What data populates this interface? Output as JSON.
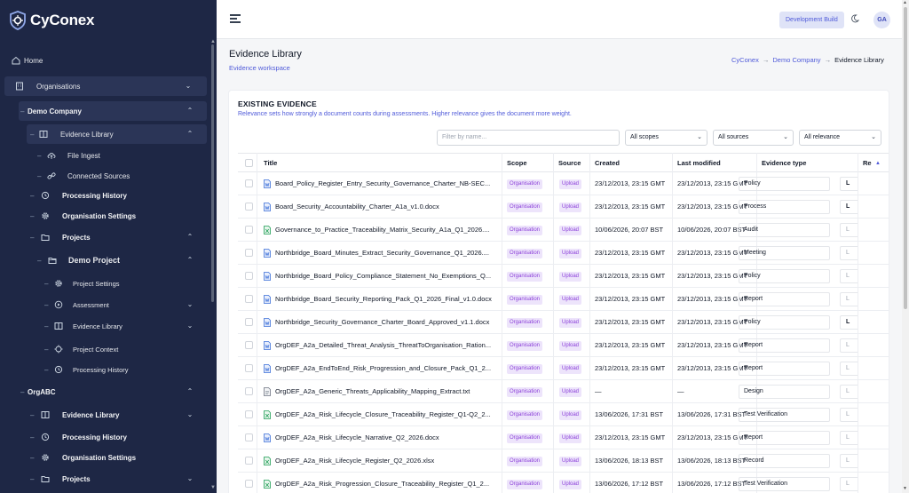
{
  "app": {
    "name": "CyConex"
  },
  "sidebar": {
    "home": "Home",
    "organisations": "Organisations",
    "demo_company": {
      "label": "Demo Company",
      "evidence_library": "Evidence Library",
      "file_ingest": "File Ingest",
      "connected_sources": "Connected Sources",
      "processing_history": "Processing History",
      "organisation_settings": "Organisation Settings",
      "projects": "Projects",
      "demo_project": {
        "label": "Demo Project",
        "project_settings": "Project Settings",
        "assessment": "Assessment",
        "evidence_library": "Evidence Library",
        "project_context": "Project Context",
        "processing_history": "Processing History"
      }
    },
    "org_abc": {
      "label": "OrgABC",
      "evidence_library": "Evidence Library",
      "processing_history": "Processing History",
      "organisation_settings": "Organisation Settings",
      "projects": "Projects"
    }
  },
  "topbar": {
    "dev_build": "Development Build",
    "avatar": "GA"
  },
  "page": {
    "title": "Evidence Library",
    "subtitle": "Evidence workspace",
    "breadcrumb": [
      "CyConex",
      "Demo Company",
      "Evidence Library"
    ]
  },
  "card": {
    "title": "EXISTING EVIDENCE",
    "description": "Relevance sets how strongly a document counts during assessments. Higher relevance gives the document more weight.",
    "filter_placeholder": "Filter by name...",
    "scopes": "All scopes",
    "sources": "All sources",
    "relevance": "All relevance"
  },
  "table": {
    "headers": [
      "Title",
      "Scope",
      "Source",
      "Created",
      "Last modified",
      "Evidence type",
      "Re"
    ],
    "rows": [
      {
        "title": "Board_Policy_Register_Entry_Security_Governance_Charter_NB-SEC...",
        "icon": "doc",
        "scope": "Organisation",
        "source": "Upload",
        "created": "23/12/2013, 23:15 GMT",
        "modified": "23/12/2013, 23:15 GMT",
        "type": "Policy",
        "rel": "L",
        "rel_bold": true
      },
      {
        "title": "Board_Security_Accountability_Charter_A1a_v1.0.docx",
        "icon": "doc",
        "scope": "Organisation",
        "source": "Upload",
        "created": "23/12/2013, 23:15 GMT",
        "modified": "23/12/2013, 23:15 GMT",
        "type": "Process",
        "rel": "L",
        "rel_bold": true
      },
      {
        "title": "Governance_to_Practice_Traceability_Matrix_Security_A1a_Q1_2026....",
        "icon": "xls",
        "scope": "Organisation",
        "source": "Upload",
        "created": "10/06/2026, 20:07 BST",
        "modified": "10/06/2026, 20:07 BST",
        "type": "Audit",
        "rel": "L",
        "rel_bold": false
      },
      {
        "title": "Northbridge_Board_Minutes_Extract_Security_Governance_Q1_2026....",
        "icon": "doc",
        "scope": "Organisation",
        "source": "Upload",
        "created": "23/12/2013, 23:15 GMT",
        "modified": "23/12/2013, 23:15 GMT",
        "type": "Meeting",
        "rel": "L",
        "rel_bold": false
      },
      {
        "title": "Northbridge_Board_Policy_Compliance_Statement_No_Exemptions_Q...",
        "icon": "doc",
        "scope": "Organisation",
        "source": "Upload",
        "created": "23/12/2013, 23:15 GMT",
        "modified": "23/12/2013, 23:15 GMT",
        "type": "Policy",
        "rel": "L",
        "rel_bold": false
      },
      {
        "title": "Northbridge_Board_Security_Reporting_Pack_Q1_2026_Final_v1.0.docx",
        "icon": "doc",
        "scope": "Organisation",
        "source": "Upload",
        "created": "23/12/2013, 23:15 GMT",
        "modified": "23/12/2013, 23:15 GMT",
        "type": "Report",
        "rel": "L",
        "rel_bold": false
      },
      {
        "title": "Northbridge_Security_Governance_Charter_Board_Approved_v1.1.docx",
        "icon": "doc",
        "scope": "Organisation",
        "source": "Upload",
        "created": "23/12/2013, 23:15 GMT",
        "modified": "23/12/2013, 23:15 GMT",
        "type": "Policy",
        "rel": "L",
        "rel_bold": true
      },
      {
        "title": "OrgDEF_A2a_Detailed_Threat_Analysis_ThreatToOrganisation_Ration...",
        "icon": "doc",
        "scope": "Organisation",
        "source": "Upload",
        "created": "23/12/2013, 23:15 GMT",
        "modified": "23/12/2013, 23:15 GMT",
        "type": "Report",
        "rel": "L",
        "rel_bold": false
      },
      {
        "title": "OrgDEF_A2a_EndToEnd_Risk_Progression_and_Closure_Pack_Q1_2...",
        "icon": "doc",
        "scope": "Organisation",
        "source": "Upload",
        "created": "23/12/2013, 23:15 GMT",
        "modified": "23/12/2013, 23:15 GMT",
        "type": "Report",
        "rel": "L",
        "rel_bold": false
      },
      {
        "title": "OrgDEF_A2a_Generic_Threats_Applicability_Mapping_Extract.txt",
        "icon": "txt",
        "scope": "Organisation",
        "source": "Upload",
        "created": "—",
        "modified": "—",
        "type": "Design",
        "rel": "L",
        "rel_bold": false
      },
      {
        "title": "OrgDEF_A2a_Risk_Lifecycle_Closure_Traceability_Register_Q1-Q2_2...",
        "icon": "xls",
        "scope": "Organisation",
        "source": "Upload",
        "created": "13/06/2026, 17:31 BST",
        "modified": "13/06/2026, 17:31 BST",
        "type": "Test Verification",
        "rel": "L",
        "rel_bold": false
      },
      {
        "title": "OrgDEF_A2a_Risk_Lifecycle_Narrative_Q2_2026.docx",
        "icon": "doc",
        "scope": "Organisation",
        "source": "Upload",
        "created": "23/12/2013, 23:15 GMT",
        "modified": "23/12/2013, 23:15 GMT",
        "type": "Report",
        "rel": "L",
        "rel_bold": false
      },
      {
        "title": "OrgDEF_A2a_Risk_Lifecycle_Register_Q2_2026.xlsx",
        "icon": "xls",
        "scope": "Organisation",
        "source": "Upload",
        "created": "13/06/2026, 18:13 BST",
        "modified": "13/06/2026, 18:13 BST",
        "type": "Record",
        "rel": "L",
        "rel_bold": false
      },
      {
        "title": "OrgDEF_A2a_Risk_Progression_Closure_Traceability_Register_Q1_2...",
        "icon": "xls",
        "scope": "Organisation",
        "source": "Upload",
        "created": "13/06/2026, 17:12 BST",
        "modified": "13/06/2026, 17:12 BST",
        "type": "Test Verification",
        "rel": "L",
        "rel_bold": false
      }
    ]
  },
  "colors": {
    "sidebar_bg": "#1e2745",
    "accent": "#4f5ad9",
    "badge_text": "#8b3fd9",
    "badge_bg": "#ede4fb"
  }
}
